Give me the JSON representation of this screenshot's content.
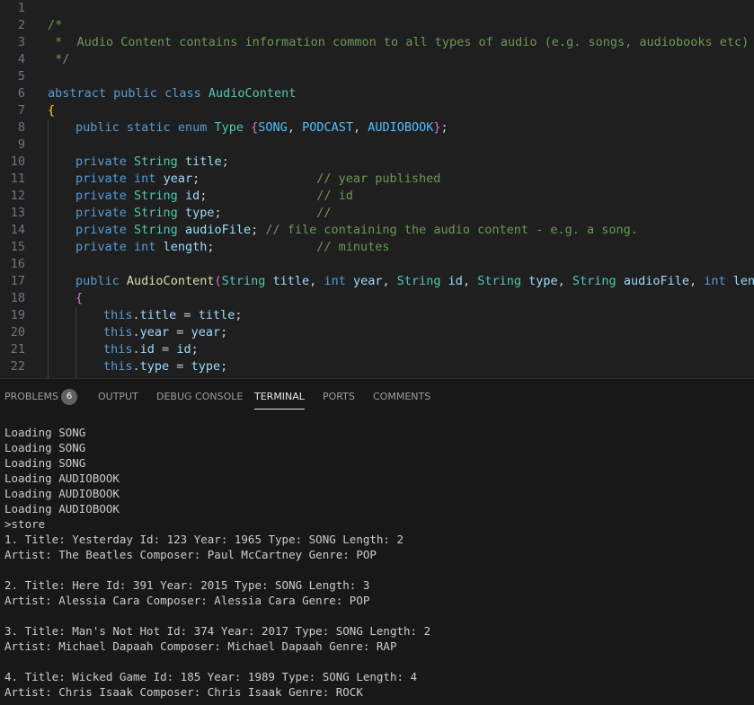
{
  "editor": {
    "lines": [
      {
        "num": "1",
        "indent": 0,
        "tokens": []
      },
      {
        "num": "2",
        "indent": 0,
        "tokens": [
          {
            "c": "cm",
            "t": "/*"
          }
        ]
      },
      {
        "num": "3",
        "indent": 0,
        "tokens": [
          {
            "c": "cm",
            "t": " *  Audio Content contains information common to all types of audio (e.g. songs, audiobooks etc)"
          }
        ]
      },
      {
        "num": "4",
        "indent": 0,
        "tokens": [
          {
            "c": "cm",
            "t": " */"
          }
        ]
      },
      {
        "num": "5",
        "indent": 0,
        "tokens": []
      },
      {
        "num": "6",
        "indent": 0,
        "tokens": [
          {
            "c": "kw",
            "t": "abstract"
          },
          {
            "c": "pl",
            "t": " "
          },
          {
            "c": "kw",
            "t": "public"
          },
          {
            "c": "pl",
            "t": " "
          },
          {
            "c": "kw",
            "t": "class"
          },
          {
            "c": "pl",
            "t": " "
          },
          {
            "c": "ty",
            "t": "AudioContent"
          }
        ]
      },
      {
        "num": "7",
        "indent": 0,
        "tokens": [
          {
            "c": "b1",
            "t": "{"
          }
        ]
      },
      {
        "num": "8",
        "indent": 1,
        "tokens": [
          {
            "c": "kw",
            "t": "public"
          },
          {
            "c": "pl",
            "t": " "
          },
          {
            "c": "kw",
            "t": "static"
          },
          {
            "c": "pl",
            "t": " "
          },
          {
            "c": "kw",
            "t": "enum"
          },
          {
            "c": "pl",
            "t": " "
          },
          {
            "c": "ty",
            "t": "Type"
          },
          {
            "c": "pl",
            "t": " "
          },
          {
            "c": "b2",
            "t": "{"
          },
          {
            "c": "en",
            "t": "SONG"
          },
          {
            "c": "pl",
            "t": ", "
          },
          {
            "c": "en",
            "t": "PODCAST"
          },
          {
            "c": "pl",
            "t": ", "
          },
          {
            "c": "en",
            "t": "AUDIOBOOK"
          },
          {
            "c": "b2",
            "t": "}"
          },
          {
            "c": "pl",
            "t": ";"
          }
        ]
      },
      {
        "num": "9",
        "indent": 1,
        "tokens": []
      },
      {
        "num": "10",
        "indent": 1,
        "tokens": [
          {
            "c": "kw",
            "t": "private"
          },
          {
            "c": "pl",
            "t": " "
          },
          {
            "c": "ty",
            "t": "String"
          },
          {
            "c": "pl",
            "t": " "
          },
          {
            "c": "vr",
            "t": "title"
          },
          {
            "c": "pl",
            "t": ";"
          }
        ]
      },
      {
        "num": "11",
        "indent": 1,
        "tokens": [
          {
            "c": "kw",
            "t": "private"
          },
          {
            "c": "pl",
            "t": " "
          },
          {
            "c": "kw",
            "t": "int"
          },
          {
            "c": "pl",
            "t": " "
          },
          {
            "c": "vr",
            "t": "year"
          },
          {
            "c": "pl",
            "t": ";                "
          },
          {
            "c": "cm",
            "t": "// year published"
          }
        ]
      },
      {
        "num": "12",
        "indent": 1,
        "tokens": [
          {
            "c": "kw",
            "t": "private"
          },
          {
            "c": "pl",
            "t": " "
          },
          {
            "c": "ty",
            "t": "String"
          },
          {
            "c": "pl",
            "t": " "
          },
          {
            "c": "vr",
            "t": "id"
          },
          {
            "c": "pl",
            "t": ";               "
          },
          {
            "c": "cm",
            "t": "// id"
          }
        ]
      },
      {
        "num": "13",
        "indent": 1,
        "tokens": [
          {
            "c": "kw",
            "t": "private"
          },
          {
            "c": "pl",
            "t": " "
          },
          {
            "c": "ty",
            "t": "String"
          },
          {
            "c": "pl",
            "t": " "
          },
          {
            "c": "vr",
            "t": "type"
          },
          {
            "c": "pl",
            "t": ";             "
          },
          {
            "c": "cm",
            "t": "//"
          }
        ]
      },
      {
        "num": "14",
        "indent": 1,
        "tokens": [
          {
            "c": "kw",
            "t": "private"
          },
          {
            "c": "pl",
            "t": " "
          },
          {
            "c": "ty",
            "t": "String"
          },
          {
            "c": "pl",
            "t": " "
          },
          {
            "c": "vr",
            "t": "audioFile"
          },
          {
            "c": "pl",
            "t": "; "
          },
          {
            "c": "cm",
            "t": "// file containing the audio content - e.g. a song."
          }
        ]
      },
      {
        "num": "15",
        "indent": 1,
        "tokens": [
          {
            "c": "kw",
            "t": "private"
          },
          {
            "c": "pl",
            "t": " "
          },
          {
            "c": "kw",
            "t": "int"
          },
          {
            "c": "pl",
            "t": " "
          },
          {
            "c": "vr",
            "t": "length"
          },
          {
            "c": "pl",
            "t": ";              "
          },
          {
            "c": "cm",
            "t": "// minutes"
          }
        ]
      },
      {
        "num": "16",
        "indent": 1,
        "tokens": []
      },
      {
        "num": "17",
        "indent": 1,
        "tokens": [
          {
            "c": "kw",
            "t": "public"
          },
          {
            "c": "pl",
            "t": " "
          },
          {
            "c": "fn",
            "t": "AudioContent"
          },
          {
            "c": "b2",
            "t": "("
          },
          {
            "c": "ty",
            "t": "String"
          },
          {
            "c": "pl",
            "t": " "
          },
          {
            "c": "vr",
            "t": "title"
          },
          {
            "c": "pl",
            "t": ", "
          },
          {
            "c": "kw",
            "t": "int"
          },
          {
            "c": "pl",
            "t": " "
          },
          {
            "c": "vr",
            "t": "year"
          },
          {
            "c": "pl",
            "t": ", "
          },
          {
            "c": "ty",
            "t": "String"
          },
          {
            "c": "pl",
            "t": " "
          },
          {
            "c": "vr",
            "t": "id"
          },
          {
            "c": "pl",
            "t": ", "
          },
          {
            "c": "ty",
            "t": "String"
          },
          {
            "c": "pl",
            "t": " "
          },
          {
            "c": "vr",
            "t": "type"
          },
          {
            "c": "pl",
            "t": ", "
          },
          {
            "c": "ty",
            "t": "String"
          },
          {
            "c": "pl",
            "t": " "
          },
          {
            "c": "vr",
            "t": "audioFile"
          },
          {
            "c": "pl",
            "t": ", "
          },
          {
            "c": "kw",
            "t": "int"
          },
          {
            "c": "pl",
            "t": " "
          },
          {
            "c": "vr",
            "t": "length"
          },
          {
            "c": "b2",
            "t": ")"
          }
        ]
      },
      {
        "num": "18",
        "indent": 1,
        "tokens": [
          {
            "c": "b2",
            "t": "{"
          }
        ]
      },
      {
        "num": "19",
        "indent": 2,
        "tokens": [
          {
            "c": "kw",
            "t": "this"
          },
          {
            "c": "pl",
            "t": "."
          },
          {
            "c": "vr",
            "t": "title"
          },
          {
            "c": "pl",
            "t": " = "
          },
          {
            "c": "vr",
            "t": "title"
          },
          {
            "c": "pl",
            "t": ";"
          }
        ]
      },
      {
        "num": "20",
        "indent": 2,
        "tokens": [
          {
            "c": "kw",
            "t": "this"
          },
          {
            "c": "pl",
            "t": "."
          },
          {
            "c": "vr",
            "t": "year"
          },
          {
            "c": "pl",
            "t": " = "
          },
          {
            "c": "vr",
            "t": "year"
          },
          {
            "c": "pl",
            "t": ";"
          }
        ]
      },
      {
        "num": "21",
        "indent": 2,
        "tokens": [
          {
            "c": "kw",
            "t": "this"
          },
          {
            "c": "pl",
            "t": "."
          },
          {
            "c": "vr",
            "t": "id"
          },
          {
            "c": "pl",
            "t": " = "
          },
          {
            "c": "vr",
            "t": "id"
          },
          {
            "c": "pl",
            "t": ";"
          }
        ]
      },
      {
        "num": "22",
        "indent": 2,
        "tokens": [
          {
            "c": "kw",
            "t": "this"
          },
          {
            "c": "pl",
            "t": "."
          },
          {
            "c": "vr",
            "t": "type"
          },
          {
            "c": "pl",
            "t": " = "
          },
          {
            "c": "vr",
            "t": "type"
          },
          {
            "c": "pl",
            "t": ";"
          }
        ]
      }
    ]
  },
  "panel": {
    "tabs": [
      {
        "label": "PROBLEMS",
        "badge": "6",
        "active": false
      },
      {
        "label": "OUTPUT",
        "active": false
      },
      {
        "label": "DEBUG CONSOLE",
        "active": false
      },
      {
        "label": "TERMINAL",
        "active": true
      },
      {
        "label": "PORTS",
        "active": false
      },
      {
        "label": "COMMENTS",
        "active": false
      }
    ]
  },
  "terminal": {
    "lines": [
      "Loading SONG",
      "Loading SONG",
      "Loading SONG",
      "Loading AUDIOBOOK",
      "Loading AUDIOBOOK",
      "Loading AUDIOBOOK",
      ">store",
      "1. Title: Yesterday Id: 123 Year: 1965 Type: SONG Length: 2",
      "Artist: The Beatles Composer: Paul McCartney Genre: POP",
      "",
      "2. Title: Here Id: 391 Year: 2015 Type: SONG Length: 3",
      "Artist: Alessia Cara Composer: Alessia Cara Genre: POP",
      "",
      "3. Title: Man's Not Hot Id: 374 Year: 2017 Type: SONG Length: 2",
      "Artist: Michael Dapaah Composer: Michael Dapaah Genre: RAP",
      "",
      "4. Title: Wicked Game Id: 185 Year: 1989 Type: SONG Length: 4",
      "Artist: Chris Isaak Composer: Chris Isaak Genre: ROCK"
    ]
  }
}
